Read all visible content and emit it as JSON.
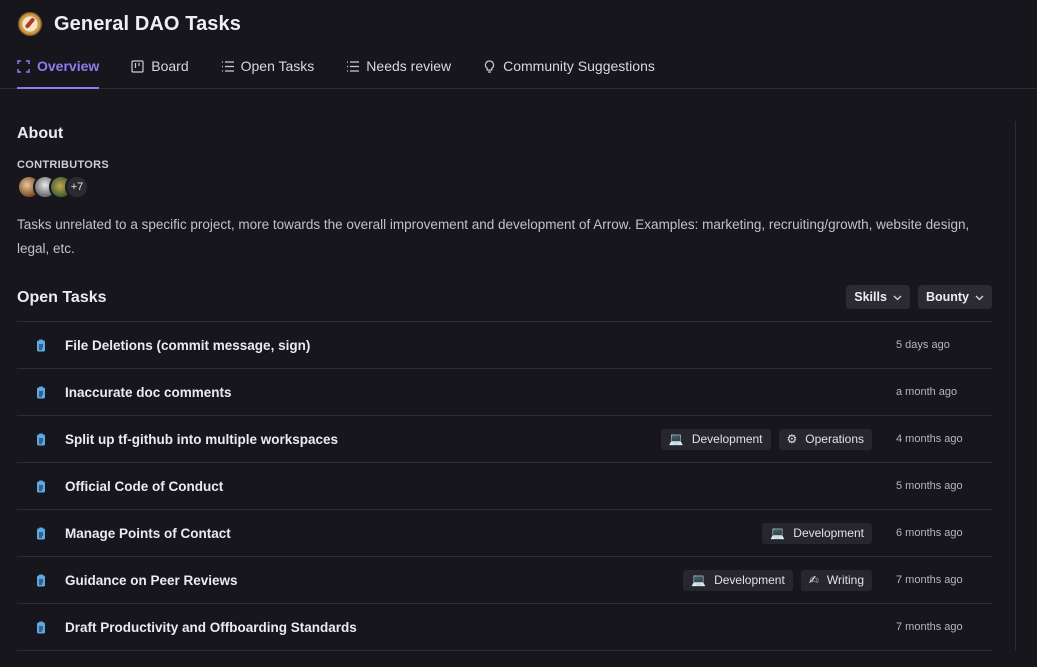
{
  "header": {
    "title": "General DAO Tasks",
    "logo_icon": "compass-logo"
  },
  "tabs": [
    {
      "label": "Overview",
      "icon": "overview-icon",
      "active": true
    },
    {
      "label": "Board",
      "icon": "board-icon",
      "active": false
    },
    {
      "label": "Open Tasks",
      "icon": "list-icon",
      "active": false
    },
    {
      "label": "Needs review",
      "icon": "list-icon",
      "active": false
    },
    {
      "label": "Community Suggestions",
      "icon": "lightbulb-icon",
      "active": false
    }
  ],
  "about": {
    "heading": "About",
    "contributors_label": "CONTRIBUTORS",
    "more_contributors": "+7",
    "description": "Tasks unrelated to a specific project, more towards the overall improvement and development of Arrow.  Examples: marketing, recruiting/growth, website design, legal, etc."
  },
  "open_tasks": {
    "heading": "Open Tasks",
    "filters": [
      {
        "label": "Skills"
      },
      {
        "label": "Bounty"
      }
    ],
    "items": [
      {
        "name": "File Deletions (commit message, sign)",
        "time": "5 days ago",
        "tags": []
      },
      {
        "name": "Inaccurate doc comments",
        "time": "a month ago",
        "tags": []
      },
      {
        "name": "Split up tf-github into multiple workspaces",
        "time": "4 months ago",
        "tags": [
          {
            "emoji": "💻",
            "label": "Development"
          },
          {
            "emoji": "⚙",
            "label": "Operations"
          }
        ]
      },
      {
        "name": "Official Code of Conduct",
        "time": "5 months ago",
        "tags": []
      },
      {
        "name": "Manage Points of Contact",
        "time": "6 months ago",
        "tags": [
          {
            "emoji": "💻",
            "label": "Development"
          }
        ]
      },
      {
        "name": "Guidance on Peer Reviews",
        "time": "7 months ago",
        "tags": [
          {
            "emoji": "💻",
            "label": "Development"
          },
          {
            "emoji": "✍",
            "label": "Writing"
          }
        ]
      },
      {
        "name": "Draft Productivity and Offboarding Standards",
        "time": "7 months ago",
        "tags": []
      }
    ]
  },
  "colors": {
    "accent": "#8d7cf0",
    "background": "#17161c",
    "task_icon": "#5aa9e6"
  }
}
